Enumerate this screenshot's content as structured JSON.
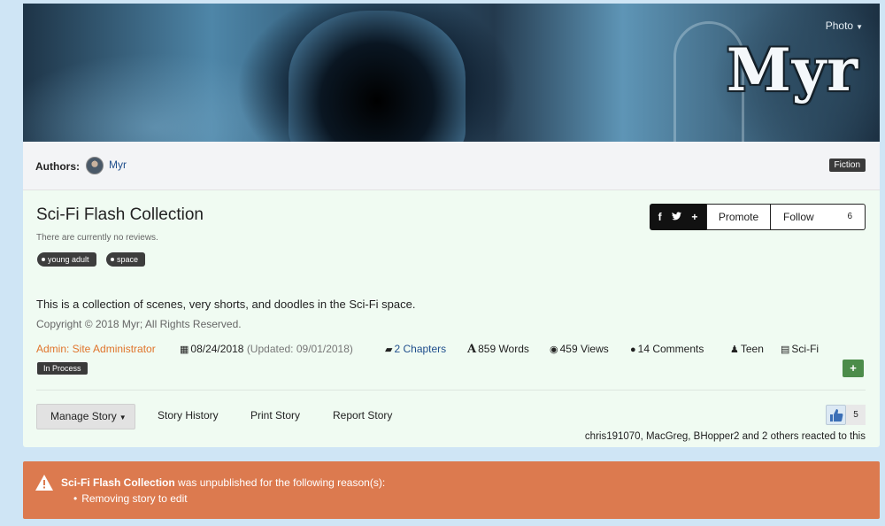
{
  "header": {
    "photo_menu": "Photo",
    "logo_text": "Myr"
  },
  "authors": {
    "label": "Authors:",
    "name": "Myr",
    "category": "Fiction"
  },
  "story": {
    "title": "Sci-Fi Flash Collection",
    "reviews_note": "There are currently no reviews.",
    "tags": [
      "young adult",
      "space"
    ],
    "description": "This is a collection of scenes, very shorts, and doodles in the Sci-Fi space.",
    "copyright": "Copyright © 2018 Myr; All Rights Reserved.",
    "status": "In Process",
    "meta": {
      "admin": "Admin: Site Administrator",
      "date": "08/24/2018",
      "updated": "(Updated: 09/01/2018)",
      "chapters": "2 Chapters",
      "words": "859 Words",
      "views": "459 Views",
      "comments": "14 Comments",
      "rating": "Teen",
      "genre": "Sci-Fi"
    }
  },
  "share": {
    "facebook": "f",
    "twitter": "🐦",
    "plus": "+"
  },
  "buttons": {
    "promote": "Promote",
    "follow": "Follow",
    "follow_count": "6",
    "manage_story": "Manage Story",
    "story_history": "Story History",
    "print_story": "Print Story",
    "report_story": "Report Story",
    "add": "+"
  },
  "reactions": {
    "count": "5",
    "text": "chris191070, MacGreg, BHopper2 and 2 others reacted to this"
  },
  "alert": {
    "story_name": "Sci-Fi Flash Collection",
    "message": " was unpublished for the following reason(s):",
    "reason": "Removing story to edit",
    "color": "#dc7a4f"
  },
  "colors": {
    "page_bg": "#cfe5f5",
    "panel_bg": "#f0fbf2",
    "accent_orange": "#e0742b",
    "link_blue": "#1f4e8c",
    "add_green": "#4c8c4a"
  }
}
